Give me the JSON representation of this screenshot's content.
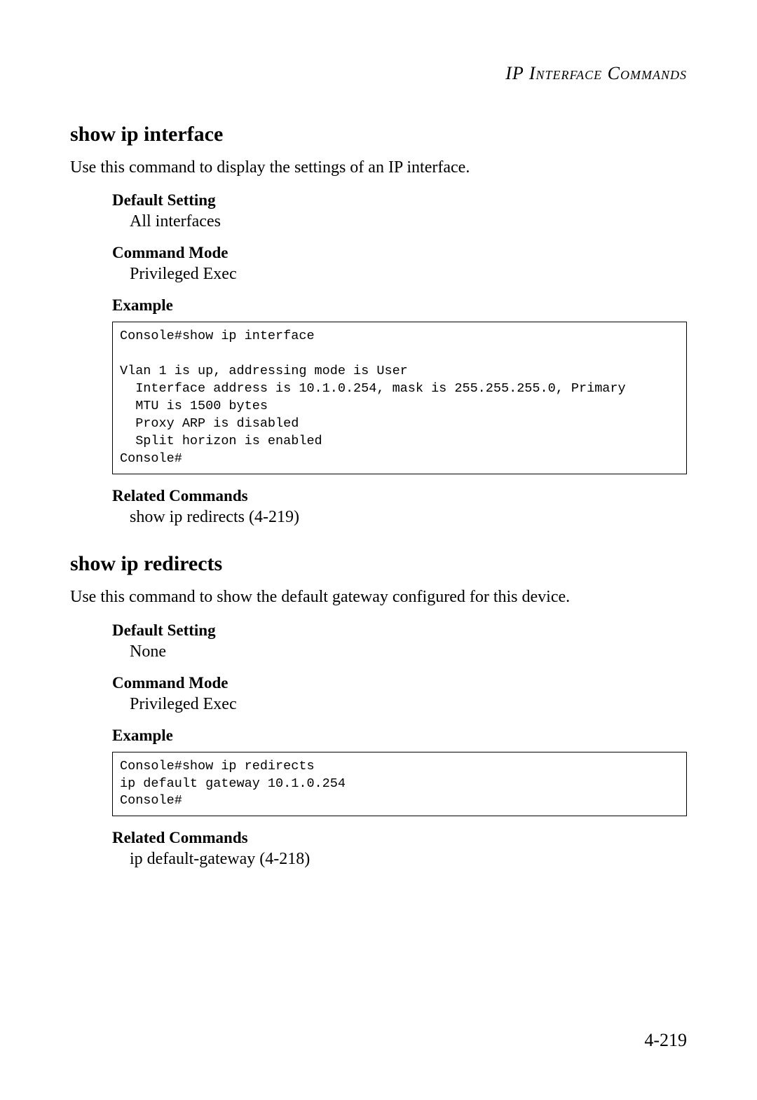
{
  "header": {
    "running_title": "IP Interface Commands"
  },
  "sections": [
    {
      "heading": "show ip interface",
      "description": "Use this command to display the settings of an IP interface.",
      "default_setting_label": "Default Setting",
      "default_setting": "All interfaces",
      "command_mode_label": "Command Mode",
      "command_mode": "Privileged Exec",
      "example_label": "Example",
      "example_code": "Console#show ip interface\n\nVlan 1 is up, addressing mode is User\n  Interface address is 10.1.0.254, mask is 255.255.255.0, Primary\n  MTU is 1500 bytes\n  Proxy ARP is disabled\n  Split horizon is enabled\nConsole#",
      "related_label": "Related Commands",
      "related": "show ip redirects (4-219)"
    },
    {
      "heading": "show ip redirects",
      "description": "Use this command to show the default gateway configured for this device.",
      "default_setting_label": "Default Setting",
      "default_setting": "None",
      "command_mode_label": "Command Mode",
      "command_mode": "Privileged Exec",
      "example_label": "Example",
      "example_code": "Console#show ip redirects\nip default gateway 10.1.0.254\nConsole#",
      "related_label": "Related Commands",
      "related": "ip default-gateway (4-218)"
    }
  ],
  "page_number": "4-219"
}
